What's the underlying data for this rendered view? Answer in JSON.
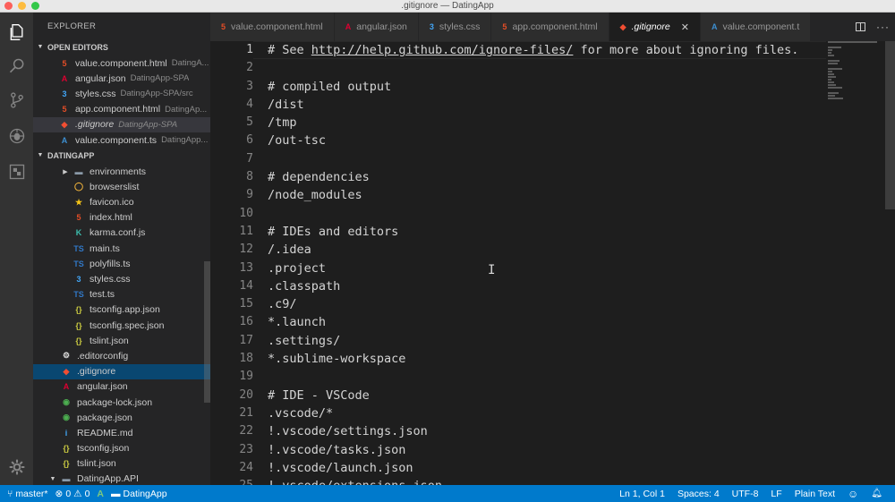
{
  "window": {
    "title": ".gitignore — DatingApp"
  },
  "sidebar": {
    "title": "EXPLORER",
    "open_editors": {
      "header": "OPEN EDITORS",
      "items": [
        {
          "icon": "html-file-icon",
          "glyph": "5",
          "color": "#e44d26",
          "label": "value.component.html",
          "desc": "DatingA...",
          "italic": false,
          "active": false
        },
        {
          "icon": "angular-file-icon",
          "glyph": "A",
          "color": "#dd0031",
          "label": "angular.json",
          "desc": "DatingApp-SPA",
          "italic": false,
          "active": false
        },
        {
          "icon": "css-file-icon",
          "glyph": "3",
          "color": "#42a5f5",
          "label": "styles.css",
          "desc": "DatingApp-SPA/src",
          "italic": false,
          "active": false
        },
        {
          "icon": "html-file-icon",
          "glyph": "5",
          "color": "#e44d26",
          "label": "app.component.html",
          "desc": "DatingAp...",
          "italic": false,
          "active": false
        },
        {
          "icon": "git-file-icon",
          "glyph": "◆",
          "color": "#f14e32",
          "label": ".gitignore",
          "desc": "DatingApp-SPA",
          "italic": true,
          "active": true
        },
        {
          "icon": "angular-ts-file-icon",
          "glyph": "A",
          "color": "#3d8fd1",
          "label": "value.component.ts",
          "desc": "DatingApp...",
          "italic": false,
          "active": false
        }
      ]
    },
    "project": {
      "header": "DATINGAPP",
      "items": [
        {
          "icon": "folder-icon",
          "glyph": "▬",
          "color": "#8a9aa8",
          "label": "environments",
          "indent": 30,
          "folder": true,
          "selected": false
        },
        {
          "icon": "browserslist-file-icon",
          "glyph": "◯",
          "color": "#f6b73c",
          "label": "browserslist",
          "indent": 44,
          "folder": false,
          "selected": false
        },
        {
          "icon": "favicon-file-icon",
          "glyph": "★",
          "color": "#f5c518",
          "label": "favicon.ico",
          "indent": 44,
          "folder": false,
          "selected": false
        },
        {
          "icon": "html-file-icon",
          "glyph": "5",
          "color": "#e44d26",
          "label": "index.html",
          "indent": 44,
          "folder": false,
          "selected": false
        },
        {
          "icon": "karma-file-icon",
          "glyph": "K",
          "color": "#3cbeae",
          "label": "karma.conf.js",
          "indent": 44,
          "folder": false,
          "selected": false
        },
        {
          "icon": "typescript-file-icon",
          "glyph": "TS",
          "color": "#3178c6",
          "label": "main.ts",
          "indent": 44,
          "folder": false,
          "selected": false
        },
        {
          "icon": "typescript-file-icon",
          "glyph": "TS",
          "color": "#3178c6",
          "label": "polyfills.ts",
          "indent": 44,
          "folder": false,
          "selected": false
        },
        {
          "icon": "css-file-icon",
          "glyph": "3",
          "color": "#42a5f5",
          "label": "styles.css",
          "indent": 44,
          "folder": false,
          "selected": false
        },
        {
          "icon": "typescript-file-icon",
          "glyph": "TS",
          "color": "#3178c6",
          "label": "test.ts",
          "indent": 44,
          "folder": false,
          "selected": false
        },
        {
          "icon": "json-file-icon",
          "glyph": "{}",
          "color": "#cbcb41",
          "label": "tsconfig.app.json",
          "indent": 44,
          "folder": false,
          "selected": false
        },
        {
          "icon": "json-file-icon",
          "glyph": "{}",
          "color": "#cbcb41",
          "label": "tsconfig.spec.json",
          "indent": 44,
          "folder": false,
          "selected": false
        },
        {
          "icon": "json-file-icon",
          "glyph": "{}",
          "color": "#cbcb41",
          "label": "tslint.json",
          "indent": 44,
          "folder": false,
          "selected": false
        },
        {
          "icon": "editorconfig-file-icon",
          "glyph": "⚙",
          "color": "#dddddd",
          "label": ".editorconfig",
          "indent": 30,
          "folder": false,
          "selected": false
        },
        {
          "icon": "git-file-icon",
          "glyph": "◆",
          "color": "#f14e32",
          "label": ".gitignore",
          "indent": 30,
          "folder": false,
          "selected": true
        },
        {
          "icon": "angular-file-icon",
          "glyph": "A",
          "color": "#dd0031",
          "label": "angular.json",
          "indent": 30,
          "folder": false,
          "selected": false
        },
        {
          "icon": "npm-file-icon",
          "glyph": "◉",
          "color": "#4caf50",
          "label": "package-lock.json",
          "indent": 30,
          "folder": false,
          "selected": false
        },
        {
          "icon": "npm-file-icon",
          "glyph": "◉",
          "color": "#4caf50",
          "label": "package.json",
          "indent": 30,
          "folder": false,
          "selected": false
        },
        {
          "icon": "info-file-icon",
          "glyph": "i",
          "color": "#42a5f5",
          "label": "README.md",
          "indent": 30,
          "folder": false,
          "selected": false
        },
        {
          "icon": "json-file-icon",
          "glyph": "{}",
          "color": "#cbcb41",
          "label": "tsconfig.json",
          "indent": 30,
          "folder": false,
          "selected": false
        },
        {
          "icon": "json-file-icon",
          "glyph": "{}",
          "color": "#cbcb41",
          "label": "tslint.json",
          "indent": 30,
          "folder": false,
          "selected": false
        },
        {
          "icon": "folder-icon",
          "glyph": "▬",
          "color": "#8a9aa8",
          "label": "DatingApp.API",
          "indent": 16,
          "folder": true,
          "selected": false
        }
      ]
    }
  },
  "tabs": [
    {
      "icon": "html-file-icon",
      "glyph": "5",
      "color": "#e44d26",
      "label": "value.component.html",
      "active": false,
      "italic": false
    },
    {
      "icon": "angular-file-icon",
      "glyph": "A",
      "color": "#dd0031",
      "label": "angular.json",
      "active": false,
      "italic": false
    },
    {
      "icon": "css-file-icon",
      "glyph": "3",
      "color": "#42a5f5",
      "label": "styles.css",
      "active": false,
      "italic": false
    },
    {
      "icon": "html-file-icon",
      "glyph": "5",
      "color": "#e44d26",
      "label": "app.component.html",
      "active": false,
      "italic": false
    },
    {
      "icon": "git-file-icon",
      "glyph": "◆",
      "color": "#f14e32",
      "label": ".gitignore",
      "active": true,
      "italic": true
    },
    {
      "icon": "angular-ts-file-icon",
      "glyph": "A",
      "color": "#3d8fd1",
      "label": "value.component.t",
      "active": false,
      "italic": false
    }
  ],
  "editor": {
    "current_line": 1,
    "lines": [
      "# See http://help.github.com/ignore-files/ for more about ignoring files.",
      "",
      "# compiled output",
      "/dist",
      "/tmp",
      "/out-tsc",
      "",
      "# dependencies",
      "/node_modules",
      "",
      "# IDEs and editors",
      "/.idea",
      ".project",
      ".classpath",
      ".c9/",
      "*.launch",
      ".settings/",
      "*.sublime-workspace",
      "",
      "# IDE - VSCode",
      ".vscode/*",
      "!.vscode/settings.json",
      "!.vscode/tasks.json",
      "!.vscode/launch.json",
      "!.vscode/extensions.json"
    ],
    "link_text": "http://help.github.com/ignore-files/"
  },
  "statusbar": {
    "branch": "master*",
    "errors": "0",
    "warnings": "0",
    "folder": "DatingApp",
    "position": "Ln 1, Col 1",
    "spaces": "Spaces: 4",
    "encoding": "UTF-8",
    "eol": "LF",
    "language": "Plain Text"
  },
  "colors": {
    "statusbar": "#007acc",
    "selection": "#094771",
    "editor_bg": "#1e1e1e"
  }
}
